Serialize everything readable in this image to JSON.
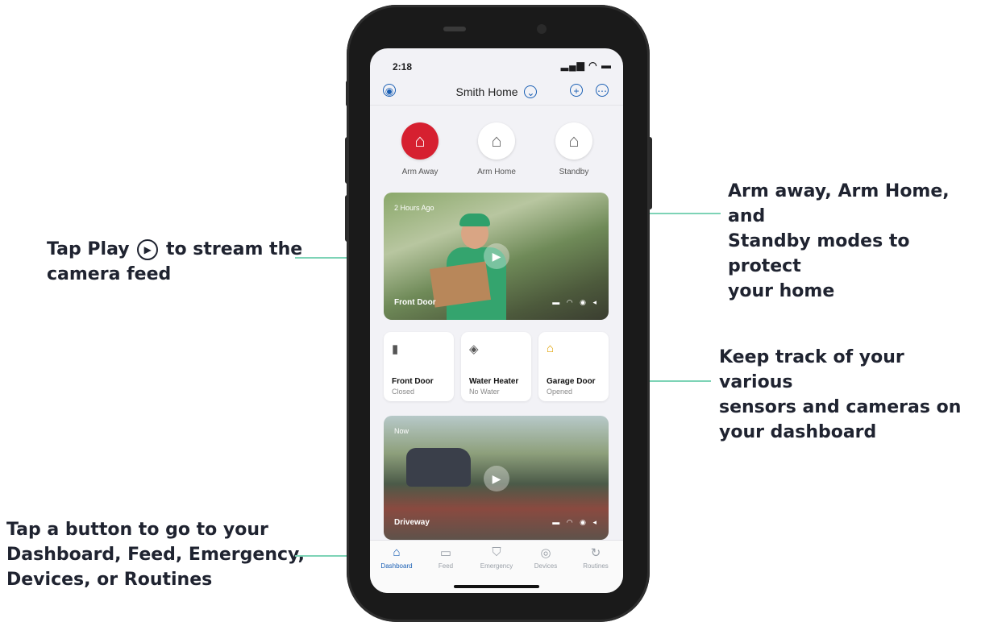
{
  "callouts": {
    "modes_line1": "Arm away, Arm Home, and",
    "modes_line2": "Standby modes to protect",
    "modes_line3": "your home",
    "play_prefix": "Tap Play",
    "play_suffix": "to stream the",
    "play_line2": "camera feed",
    "sensors_line1": "Keep track of your various",
    "sensors_line2": "sensors and cameras on",
    "sensors_line3": "your dashboard",
    "tabs_line1": "Tap a button to go to your",
    "tabs_line2": "Dashboard, Feed, Emergency,",
    "tabs_line3": "Devices, or Routines"
  },
  "status": {
    "time": "2:18",
    "icons": "▂▄▆ ◠ ▬"
  },
  "header": {
    "title": "Smith Home",
    "chevron": "⌄",
    "plus": "+",
    "more": "⋯",
    "profile": "◉"
  },
  "modes": [
    {
      "label": "Arm Away",
      "icon": "⌂",
      "active": true
    },
    {
      "label": "Arm Home",
      "icon": "⌂"
    },
    {
      "label": "Standby",
      "icon": "⌂"
    }
  ],
  "cameras": [
    {
      "time": "2 Hours Ago",
      "name": "Front Door",
      "play": "▶",
      "icons": "▬ ◠ ◉ ◂"
    },
    {
      "time": "Now",
      "name": "Driveway",
      "play": "▶",
      "icons": "▬ ◠ ◉ ◂"
    }
  ],
  "tiles": [
    {
      "name": "Front Door",
      "state": "Closed",
      "icon": "▮"
    },
    {
      "name": "Water Heater",
      "state": "No Water",
      "icon": "◈"
    },
    {
      "name": "Garage Door",
      "state": "Opened",
      "icon": "⌂"
    }
  ],
  "tabs": [
    {
      "label": "Dashboard",
      "icon": "⌂"
    },
    {
      "label": "Feed",
      "icon": "▭"
    },
    {
      "label": "Emergency",
      "icon": "⛉"
    },
    {
      "label": "Devices",
      "icon": "◎"
    },
    {
      "label": "Routines",
      "icon": "↻"
    }
  ],
  "colors": {
    "accent": "#1a5fb4",
    "arm_red": "#d62030",
    "callout_line": "#7dd3b6",
    "garage_gold": "#e0a100"
  }
}
